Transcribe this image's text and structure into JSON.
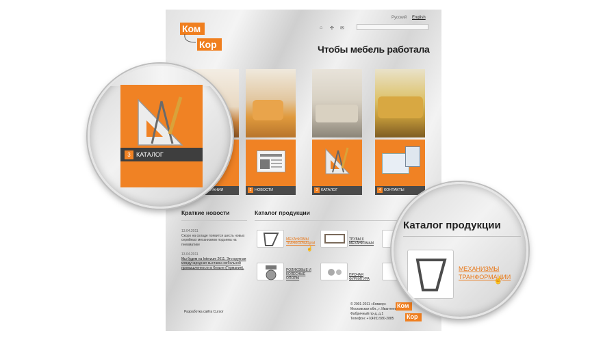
{
  "logo": {
    "line1": "Ком",
    "line2": "Кор"
  },
  "header": {
    "lang_ru": "Русский",
    "lang_en": "English",
    "slogan": "Чтобы мебель работала"
  },
  "tiles": [
    {
      "num": "1",
      "label": "О КОМПАНИИ",
      "icon": "building-icon"
    },
    {
      "num": "2",
      "label": "НОВОСТИ",
      "icon": "newspaper-icon"
    },
    {
      "num": "3",
      "label": "КАТАЛОГ",
      "icon": "drafting-tools-icon"
    },
    {
      "num": "4",
      "label": "КОНТАКТЫ",
      "icon": "envelope-pen-icon"
    }
  ],
  "news": {
    "title": "Краткие новости",
    "items": [
      {
        "date": "13.04.2011",
        "text": "Скоро на складе появится шесть новых серийных механизмов подъема на пневматике"
      },
      {
        "date": "13.04.2011",
        "text": "Мы будем на Interzum 2011. Это крупная международная выставка мебельной промышленности в Кельне (Германия)."
      }
    ]
  },
  "catalog": {
    "title": "Каталог продукции",
    "items": [
      {
        "label": "МЕХАНИЗМЫ ТРАНФОРМАЦИИ",
        "highlight": true
      },
      {
        "label": "ТРУБЫ К МЕХАНИЗМАМ",
        "highlight": false
      },
      {
        "label": "",
        "highlight": false
      },
      {
        "label": "РОЛИКОВЫЕ И КОЛЕСНЫЕ ОПОРЫ",
        "highlight": false
      },
      {
        "label": "ПРОЧАЯ ФУРНИТУРА",
        "highlight": false
      },
      {
        "label": "",
        "highlight": false
      }
    ]
  },
  "footer": {
    "developer": "Разработка сайта Cursor",
    "copyright": "© 2001-2011 «Комкор»",
    "address1": "Московская обл., г. Ивантеевка,",
    "address2": "Фабричный пр-д, д.1",
    "phone": "Телефон: +7(495) 580-2885"
  },
  "lens_left": {
    "label_num": "3",
    "label": "КАТАЛОГ"
  },
  "lens_right": {
    "title": "Каталог продукции",
    "item": "МЕХАНИЗМЫ ТРАНФОРМАЦИИ"
  },
  "colors": {
    "accent": "#f08224",
    "dark_bar": "#4a4a4a"
  }
}
